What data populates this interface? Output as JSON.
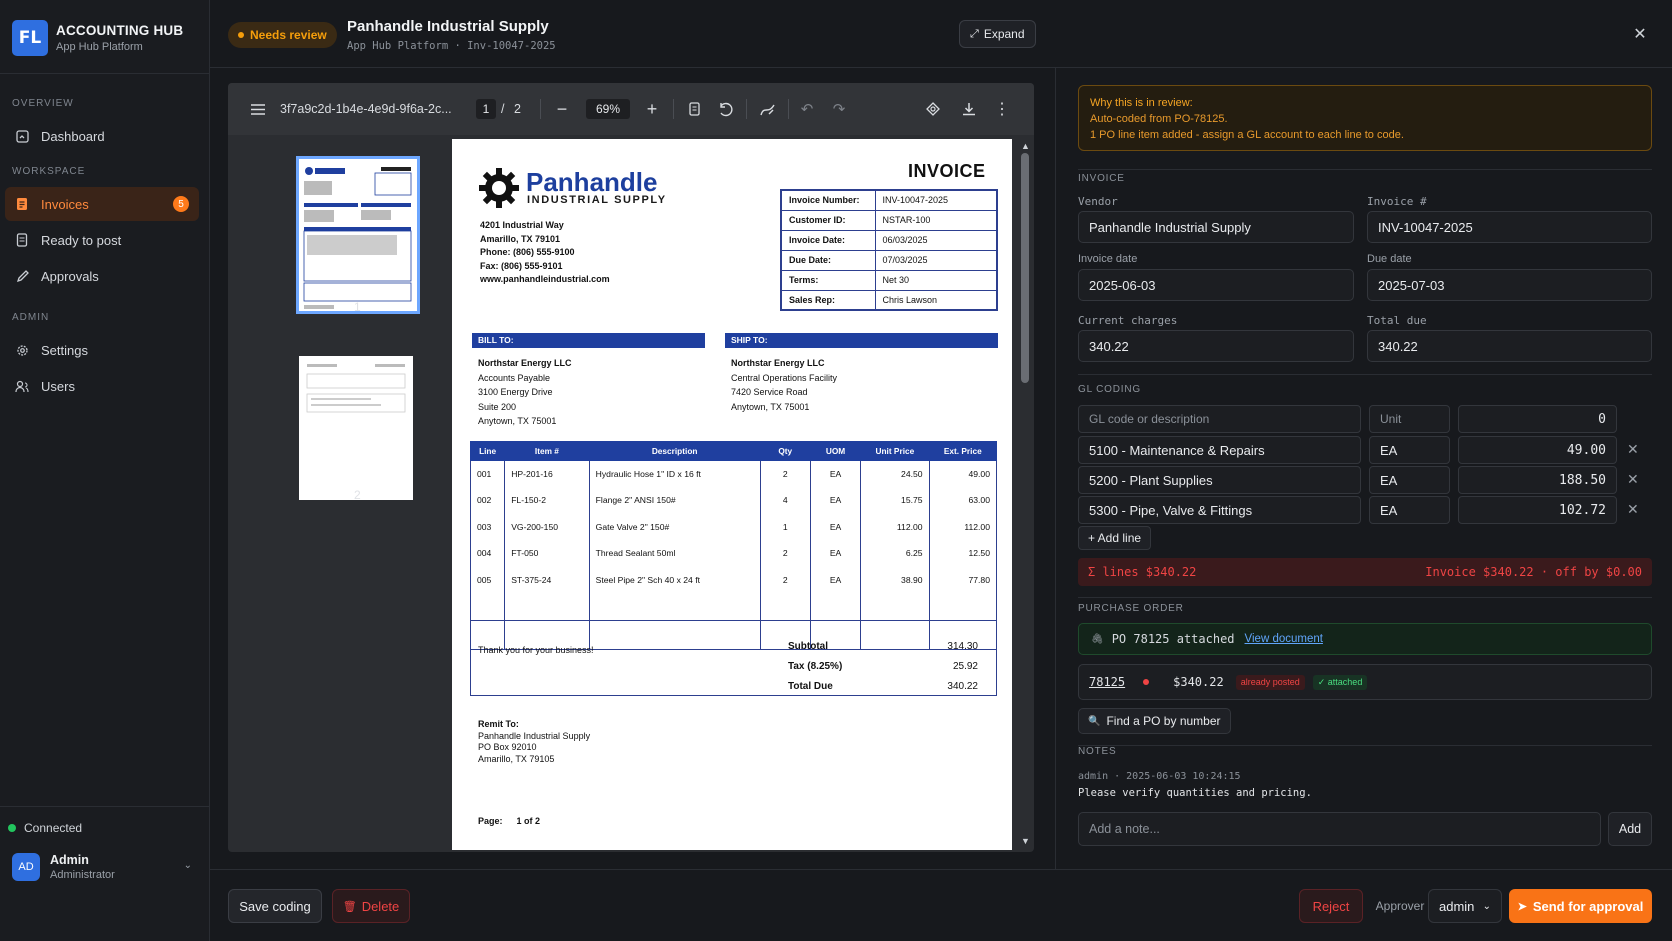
{
  "sidebar": {
    "brand_title": "ACCOUNTING HUB",
    "brand_subtitle": "App Hub Platform",
    "sections": {
      "overview": "OVERVIEW",
      "workspace": "WORKSPACE",
      "admin": "ADMIN"
    },
    "items": [
      {
        "label": "Dashboard",
        "icon": "dashboard-icon"
      },
      {
        "label": "Invoices",
        "icon": "invoice-icon",
        "active": true,
        "badge": "5"
      },
      {
        "label": "Ready to post",
        "icon": "document-icon"
      },
      {
        "label": "Approvals",
        "icon": "check-icon"
      },
      {
        "label": "Settings",
        "icon": "gear-icon"
      },
      {
        "label": "Users",
        "icon": "users-icon"
      }
    ],
    "connection": "Connected",
    "user": {
      "initials": "AD",
      "name": "Admin",
      "role": "Administrator"
    }
  },
  "header": {
    "status": "Needs review",
    "title": "Panhandle Industrial Supply",
    "subtitle": "App Hub Platform · Inv-10047-2025",
    "expand_label": "Expand"
  },
  "viewer": {
    "filename": "3f7a9c2d-1b4e-4e9d-9f6a-2c...",
    "page_current": "1",
    "page_total": "2",
    "zoom": "69%",
    "thumbs": [
      "1",
      "2"
    ]
  },
  "invoice": {
    "company_name": "Panhandle",
    "company_tag": "INDUSTRIAL SUPPLY",
    "doc_title": "INVOICE",
    "address": [
      "4201 Industrial Way",
      "Amarillo, TX 79101",
      "Phone: (806) 555-9100",
      "Fax: (806) 555-9101",
      "www.panhandleindustrial.com"
    ],
    "info": [
      {
        "k": "Invoice Number:",
        "v": "INV-10047-2025"
      },
      {
        "k": "Customer ID:",
        "v": "NSTAR-100"
      },
      {
        "k": "Invoice Date:",
        "v": "06/03/2025"
      },
      {
        "k": "Due Date:",
        "v": "07/03/2025"
      },
      {
        "k": "Terms:",
        "v": "Net 30"
      },
      {
        "k": "Sales Rep:",
        "v": "Chris Lawson"
      }
    ],
    "bill_to_label": "BILL TO:",
    "bill_to": [
      "Northstar Energy LLC",
      "Accounts Payable",
      "3100 Energy Drive",
      "Suite 200",
      "Anytown, TX 75001"
    ],
    "ship_to_label": "SHIP TO:",
    "ship_to": [
      "Northstar Energy LLC",
      "Central Operations Facility",
      "7420 Service Road",
      "Anytown, TX 75001"
    ],
    "columns": [
      "Line",
      "Item #",
      "Description",
      "Qty",
      "UOM",
      "Unit Price",
      "Ext. Price"
    ],
    "lines": [
      [
        "001",
        "HP-201-16",
        "Hydraulic Hose 1\" ID x 16 ft",
        "2",
        "EA",
        "24.50",
        "49.00"
      ],
      [
        "002",
        "FL-150-2",
        "Flange 2\" ANSI 150#",
        "4",
        "EA",
        "15.75",
        "63.00"
      ],
      [
        "003",
        "VG-200-150",
        "Gate Valve 2\" 150#",
        "1",
        "EA",
        "112.00",
        "112.00"
      ],
      [
        "004",
        "FT-050",
        "Thread Sealant 50ml",
        "2",
        "EA",
        "6.25",
        "12.50"
      ],
      [
        "005",
        "ST-375-24",
        "Steel Pipe 2\" Sch 40 x 24 ft",
        "2",
        "EA",
        "38.90",
        "77.80"
      ]
    ],
    "thanks": "Thank you for your business!",
    "totals": [
      {
        "k": "Subtotal",
        "v": "314.30"
      },
      {
        "k": "Tax (8.25%)",
        "v": "25.92"
      },
      {
        "k": "Total Due",
        "v": "340.22"
      }
    ],
    "remit_label": "Remit To:",
    "remit": [
      "Panhandle Industrial Supply",
      "PO Box 92010",
      "Amarillo, TX 79105"
    ],
    "page_label": "Page:",
    "page_value": "1 of 2"
  },
  "review": {
    "title": "Why this is in review:",
    "lines": [
      "Auto-coded from PO-78125.",
      "1 PO line item added - assign a GL account to each line to code."
    ]
  },
  "form": {
    "section": "INVOICE",
    "vendor_label": "Vendor",
    "vendor": "Panhandle Industrial Supply",
    "invno_label": "Invoice #",
    "invno": "INV-10047-2025",
    "invdate_label": "Invoice date",
    "invdate": "2025-06-03",
    "duedate_label": "Due date",
    "duedate": "2025-07-03",
    "current_label": "Current charges",
    "current": "340.22",
    "total_label": "Total due",
    "total": "340.22"
  },
  "gl": {
    "section": "GL CODING",
    "code_placeholder": "GL code or description",
    "unit_placeholder": "Unit",
    "amount_placeholder": "0",
    "lines": [
      {
        "code": "5100 - Maintenance & Repairs",
        "unit": "EA",
        "amount": "49.00"
      },
      {
        "code": "5200 - Plant Supplies",
        "unit": "EA",
        "amount": "188.50"
      },
      {
        "code": "5300 - Pipe, Valve & Fittings",
        "unit": "EA",
        "amount": "102.72"
      }
    ],
    "add_line": "+ Add line",
    "sum_left": "Σ lines $340.22",
    "sum_right": "Invoice $340.22 · off by $0.00"
  },
  "po": {
    "section": "PURCHASE ORDER",
    "attached_text": "PO 78125 attached",
    "view_link": "View document",
    "number": "78125",
    "amount": "$340.22",
    "tag_posted": "already posted",
    "tag_attached": "✓ attached",
    "find_label": "Find a PO by number"
  },
  "notes": {
    "section": "NOTES",
    "meta": "admin · 2025-06-03 10:24:15",
    "text": "Please verify quantities and pricing.",
    "placeholder": "Add a note...",
    "add_label": "Add"
  },
  "footer": {
    "save": "Save coding",
    "delete": "Delete",
    "reject": "Reject",
    "approver_label": "Approver",
    "approver": "admin",
    "send": "Send for approval"
  },
  "colors": {
    "accent": "#ff7a1a",
    "brand": "#2f6fe0",
    "invoice_blue": "#1f3f9f",
    "error": "#ef4444",
    "warning": "#f59e0b",
    "success": "#22c55e"
  }
}
